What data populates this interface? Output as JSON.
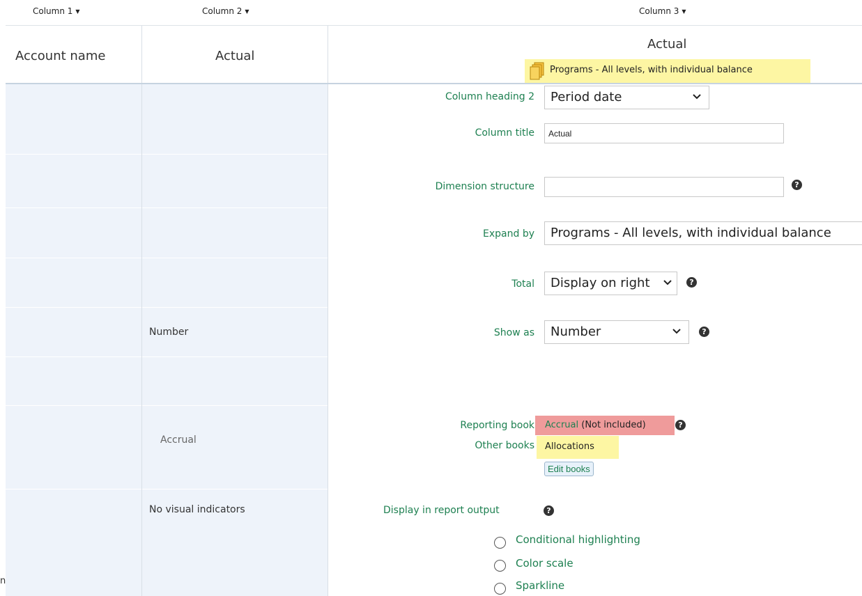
{
  "columns": [
    {
      "menu_label": "Column 1"
    },
    {
      "menu_label": "Column 2"
    },
    {
      "menu_label": "Column 3"
    }
  ],
  "header": {
    "col1_title": "Account name",
    "col2_title": "Actual",
    "col3_title": "Actual",
    "col3_badge": "Programs - All levels, with individual balance"
  },
  "col2_cells": {
    "show_as": "Number",
    "reporting_book": "Accrual",
    "visual": "No visual indicators"
  },
  "form": {
    "column_heading_2": {
      "label": "Column heading 2",
      "value": "Period date"
    },
    "column_title": {
      "label": "Column title",
      "value": "Actual"
    },
    "dimension_structure": {
      "label": "Dimension structure",
      "value": ""
    },
    "expand_by": {
      "label": "Expand by",
      "value": "Programs - All levels, with individual balance"
    },
    "total": {
      "label": "Total",
      "value": "Display on right"
    },
    "show_as": {
      "label": "Show as",
      "value": "Number"
    },
    "reporting_book": {
      "label": "Reporting book",
      "value": "Accrual",
      "status": "(Not included)"
    },
    "other_books": {
      "label": "Other books",
      "value": "Allocations"
    },
    "edit_books_label": "Edit books",
    "display_output": {
      "label": "Display in report output",
      "options": [
        "Conditional highlighting",
        "Color scale",
        "Sparkline"
      ]
    }
  },
  "edge_fragment": "n",
  "colors": {
    "label_green": "#1e8051",
    "panel_blue": "#eef3fa",
    "highlight_yellow": "#fdf6a3",
    "highlight_red": "#ef9b9b"
  }
}
